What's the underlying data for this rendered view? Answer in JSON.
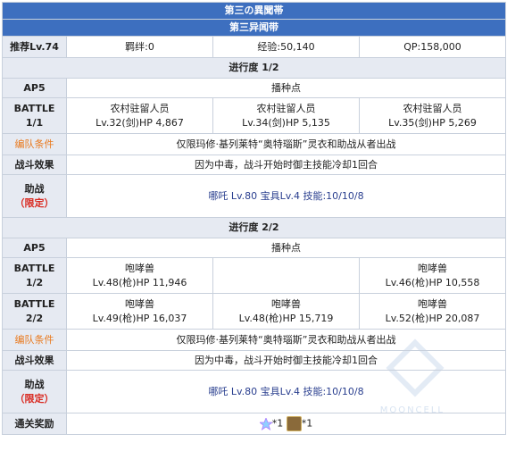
{
  "header": {
    "title_jp": "第三の異聞帯",
    "title_cn": "第三异闻带"
  },
  "summary": {
    "recommend_label": "推荐Lv.74",
    "bond": "羁绊:0",
    "exp": "经验:50,140",
    "qp": "QP:158,000"
  },
  "progress1": {
    "title": "进行度 1/2",
    "ap_label": "AP5",
    "ap_value": "播种点",
    "battle_label": "BATTLE 1/1",
    "enemies": [
      {
        "name": "农村驻留人员",
        "stats": "Lv.32(剑)HP 4,867"
      },
      {
        "name": "农村驻留人员",
        "stats": "Lv.34(剑)HP 5,135"
      },
      {
        "name": "农村驻留人员",
        "stats": "Lv.35(剑)HP 5,269"
      }
    ],
    "formation_label": "编队条件",
    "formation_text": "仅限玛修·基列莱特“奥特瑙斯”灵衣和助战从者出战",
    "battle_effect_label": "战斗效果",
    "battle_effect_text": "因为中毒，战斗开始时御主技能冷却1回合",
    "support_label": "助战",
    "support_paren": "（限定）",
    "support_text": "哪吒 Lv.80 宝具Lv.4 技能:10/10/8"
  },
  "progress2": {
    "title": "进行度 2/2",
    "ap_label": "AP5",
    "ap_value": "播种点",
    "battle1_label": "BATTLE 1/2",
    "battle1_enemies": [
      {
        "name": "咆哮兽",
        "stats": "Lv.48(枪)HP 11,946"
      },
      {
        "name": "",
        "stats": ""
      },
      {
        "name": "咆哮兽",
        "stats": "Lv.46(枪)HP 10,558"
      }
    ],
    "battle2_label": "BATTLE 2/2",
    "battle2_enemies": [
      {
        "name": "咆哮兽",
        "stats": "Lv.49(枪)HP 16,037"
      },
      {
        "name": "咆哮兽",
        "stats": "Lv.48(枪)HP 15,719"
      },
      {
        "name": "咆哮兽",
        "stats": "Lv.52(枪)HP 20,087"
      }
    ],
    "formation_label": "编队条件",
    "formation_text": "仅限玛修·基列莱特“奥特瑙斯”灵衣和助战从者出战",
    "battle_effect_label": "战斗效果",
    "battle_effect_text": "因为中毒，战斗开始时御主技能冷却1回合",
    "support_label": "助战",
    "support_paren": "（限定）",
    "support_text": "哪吒 Lv.80 宝具Lv.4 技能:10/10/8"
  },
  "reward": {
    "label": "通关奖励",
    "items": [
      {
        "icon": "saint-quartz-icon",
        "count": "*1"
      },
      {
        "icon": "material-item-icon",
        "count": "*1"
      }
    ]
  },
  "watermark": "MOONCELL",
  "colors": {
    "header": "#3d6fbf",
    "label_bg": "#e6eaf2",
    "orange": "#e97a1f",
    "red": "#d9281f",
    "border": "#c8d0dc"
  }
}
